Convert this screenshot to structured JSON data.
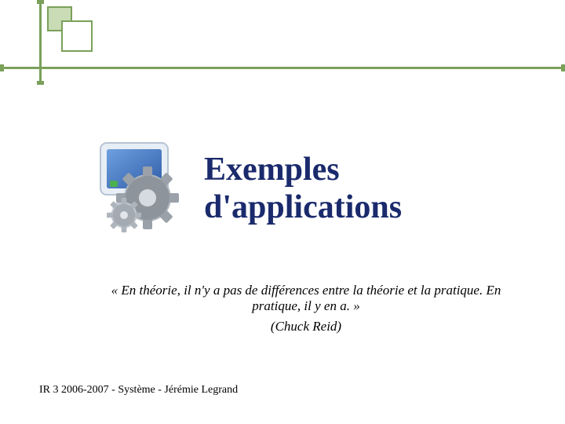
{
  "title_line1": "Exemples",
  "title_line2": "d'applications",
  "quote": "« En théorie, il n'y a pas de différences entre la théorie et la pratique. En pratique, il y en a. »",
  "attribution": "(Chuck Reid)",
  "footer": "IR 3 2006-2007  -  Système  -  Jérémie Legrand",
  "colors": {
    "accent_green": "#7aa05a",
    "title_navy": "#1a2a6c"
  }
}
